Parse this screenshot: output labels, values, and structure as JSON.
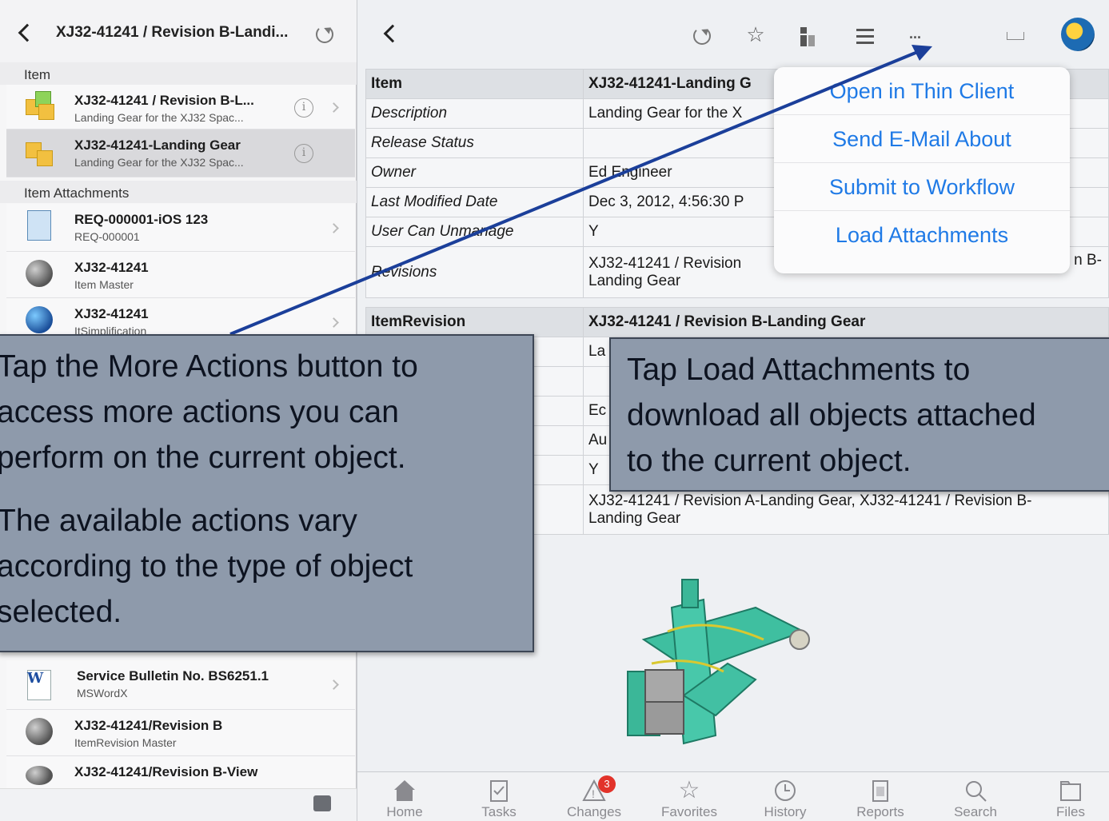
{
  "left_panel": {
    "title": "XJ32-41241 / Revision B-Landi...",
    "sections": {
      "item": "Item",
      "attachments": "Item Attachments"
    },
    "items": [
      {
        "title": "XJ32-41241 / Revision B-L...",
        "subtitle": "Landing Gear for the XJ32 Spac..."
      },
      {
        "title": "XJ32-41241-Landing Gear",
        "subtitle": "Landing Gear for the XJ32 Spac..."
      }
    ],
    "attachments": [
      {
        "title": "REQ-000001-iOS 123",
        "subtitle": "REQ-000001"
      },
      {
        "title": "XJ32-41241",
        "subtitle": "Item Master"
      },
      {
        "title": "XJ32-41241",
        "subtitle": "ItSimplification"
      },
      {
        "title": "Service Bulletin No. BS6251.1",
        "subtitle": "MSWordX"
      },
      {
        "title": "XJ32-41241/Revision B",
        "subtitle": "ItemRevision Master"
      },
      {
        "title": "XJ32-41241/Revision B-View",
        "subtitle": ""
      }
    ]
  },
  "toolbar": {
    "more_label": "..."
  },
  "properties_item": [
    {
      "key": "Item",
      "value": "XJ32-41241-Landing G"
    },
    {
      "key": "Description",
      "value": "Landing Gear for the X"
    },
    {
      "key": "Release Status",
      "value": ""
    },
    {
      "key": "Owner",
      "value": "Ed Engineer"
    },
    {
      "key": "Last Modified Date",
      "value": "Dec 3, 2012, 4:56:30 P"
    },
    {
      "key": "User Can Unmanage",
      "value": "Y"
    },
    {
      "key": "Revisions",
      "value_line1": "XJ32-41241 / Revision",
      "value_tail": "n B-",
      "value_line2": "Landing Gear"
    }
  ],
  "properties_revision": {
    "header_key": "ItemRevision",
    "header_value": "XJ32-41241 / Revision B-Landing Gear",
    "partial_values": [
      "La",
      "",
      "Ec",
      "Au",
      "Y"
    ],
    "revisions_line1": "XJ32-41241 / Revision A-Landing Gear, XJ32-41241 / Revision B-",
    "revisions_line2": "Landing Gear"
  },
  "menu": [
    "Open in Thin Client",
    "Send E-Mail About",
    "Submit to Workflow",
    "Load Attachments"
  ],
  "tabs": [
    {
      "label": "Home",
      "icon": "home-icon"
    },
    {
      "label": "Tasks",
      "icon": "tasks-icon"
    },
    {
      "label": "Changes",
      "icon": "changes-icon",
      "badge": "3"
    },
    {
      "label": "Favorites",
      "icon": "star-icon"
    },
    {
      "label": "History",
      "icon": "clock-icon"
    },
    {
      "label": "Reports",
      "icon": "reports-icon"
    },
    {
      "label": "Search",
      "icon": "search-icon"
    },
    {
      "label": "Files",
      "icon": "folder-icon"
    }
  ],
  "callouts": {
    "more_actions": {
      "p1_l1": "Tap the More Actions button to",
      "p1_l2": "access more actions you can",
      "p1_l3": "perform on the current object.",
      "p2_l1": "The available actions vary",
      "p2_l2": "according to the type of object",
      "p2_l3": "selected."
    },
    "load_attachments": {
      "l1": "Tap Load Attachments to",
      "l2": "download all objects attached",
      "l3": "to the current object."
    }
  },
  "colors": {
    "accent": "#1f7ae6",
    "callout_bg": "#8e9aab",
    "arrow": "#1b3f9a",
    "badge": "#e2332a"
  }
}
